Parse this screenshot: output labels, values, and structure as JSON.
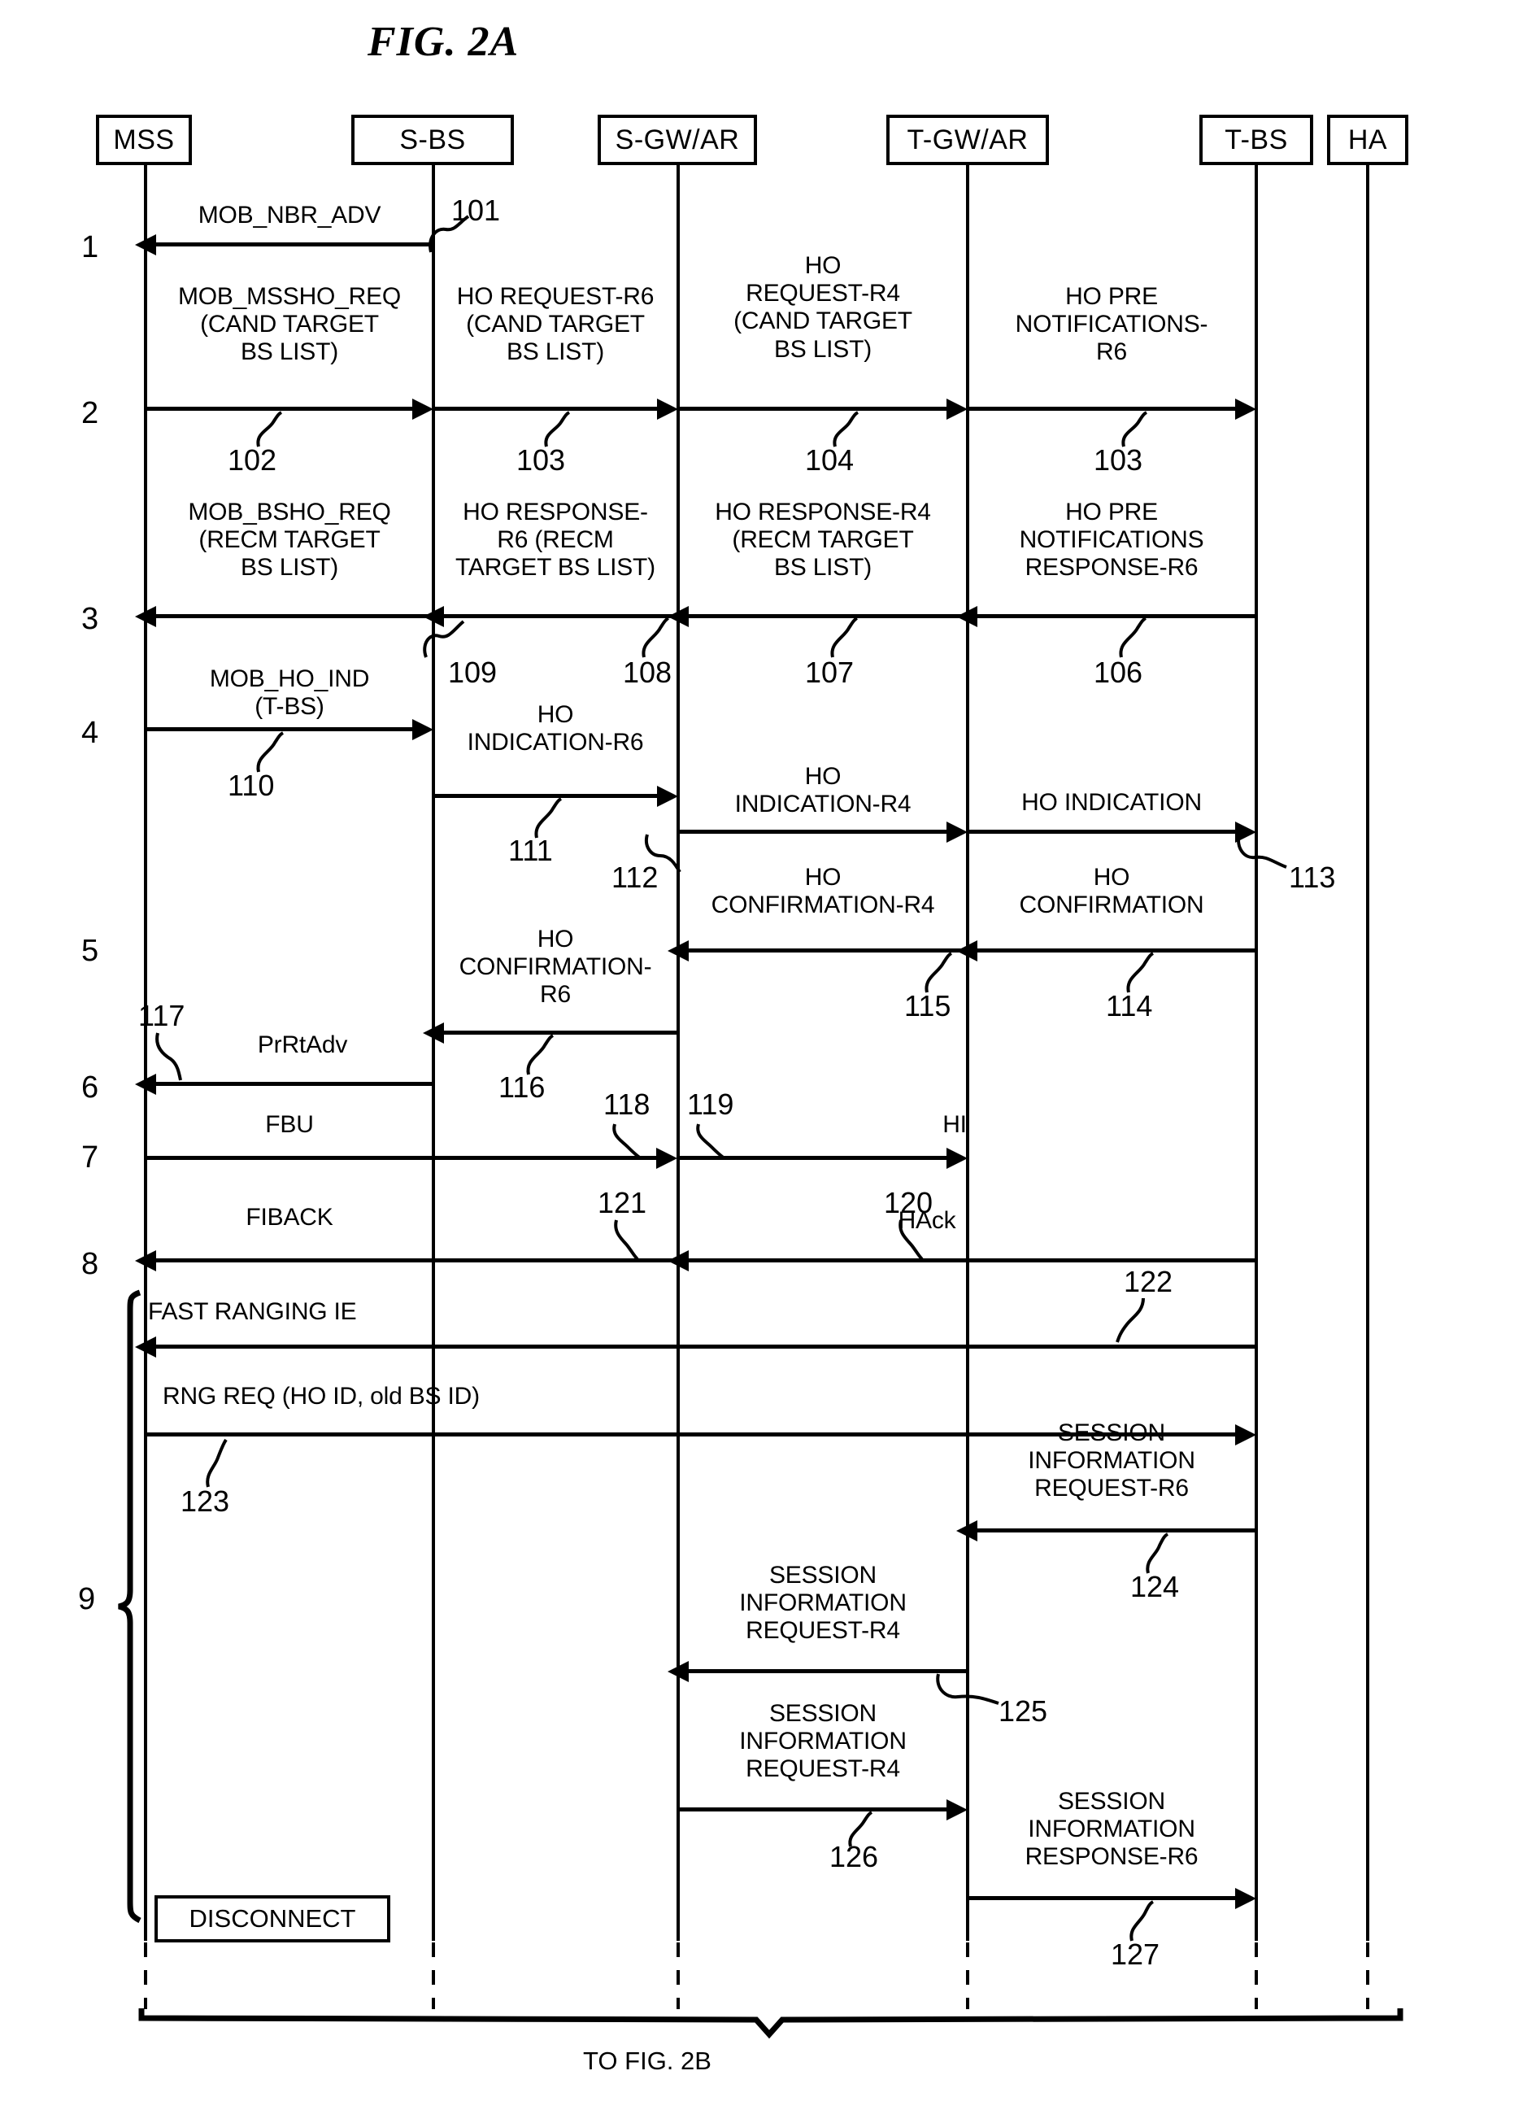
{
  "figure": {
    "title": "FIG. 2A",
    "bottom_caption": "TO FIG. 2B"
  },
  "entities": [
    {
      "id": "mss",
      "label": "MSS"
    },
    {
      "id": "sbs",
      "label": "S-BS"
    },
    {
      "id": "sgwar",
      "label": "S-GW/AR"
    },
    {
      "id": "tgwar",
      "label": "T-GW/AR"
    },
    {
      "id": "tbs",
      "label": "T-BS"
    },
    {
      "id": "ha",
      "label": "HA"
    }
  ],
  "step_numbers": [
    "1",
    "2",
    "3",
    "4",
    "5",
    "6",
    "7",
    "8",
    "9"
  ],
  "messages": [
    {
      "id": "m101",
      "label": "MOB_NBR_ADV",
      "from": "sbs",
      "to": "mss",
      "dir": "left",
      "ref": "101"
    },
    {
      "id": "m102",
      "label": "MOB_MSSHO_REQ\n(CAND TARGET\nBS LIST)",
      "from": "mss",
      "to": "sbs",
      "dir": "right",
      "ref": "102"
    },
    {
      "id": "m103",
      "label": "HO REQUEST-R6\n(CAND TARGET\nBS LIST)",
      "from": "sbs",
      "to": "sgwar",
      "dir": "right",
      "ref": "103"
    },
    {
      "id": "m104",
      "label": "HO\nREQUEST-R4\n(CAND TARGET\nBS LIST)",
      "from": "sgwar",
      "to": "tgwar",
      "dir": "right",
      "ref": "104"
    },
    {
      "id": "m105",
      "label": "HO PRE\nNOTIFICATIONS-\nR6",
      "from": "tgwar",
      "to": "tbs",
      "dir": "right",
      "ref": "103"
    },
    {
      "id": "m106",
      "label": "HO PRE\nNOTIFICATIONS\nRESPONSE-R6",
      "from": "tbs",
      "to": "tgwar",
      "dir": "left",
      "ref": "106"
    },
    {
      "id": "m107",
      "label": "HO RESPONSE-R4\n(RECM TARGET\nBS LIST)",
      "from": "tgwar",
      "to": "sgwar",
      "dir": "left",
      "ref": "107"
    },
    {
      "id": "m108",
      "label": "HO RESPONSE-\nR6 (RECM\nTARGET BS LIST)",
      "from": "sgwar",
      "to": "sbs",
      "dir": "left",
      "ref": "108"
    },
    {
      "id": "m109",
      "label": "MOB_BSHO_REQ\n(RECM TARGET\nBS LIST)",
      "from": "sbs",
      "to": "mss",
      "dir": "left",
      "ref": "109"
    },
    {
      "id": "m110",
      "label": "MOB_HO_IND\n(T-BS)",
      "from": "mss",
      "to": "sbs",
      "dir": "right",
      "ref": "110"
    },
    {
      "id": "m111",
      "label": "HO\nINDICATION-R6",
      "from": "sbs",
      "to": "sgwar",
      "dir": "right",
      "ref": "111"
    },
    {
      "id": "m112",
      "label": "HO\nINDICATION-R4",
      "from": "sgwar",
      "to": "tgwar",
      "dir": "right",
      "ref": "112"
    },
    {
      "id": "m113",
      "label": "HO INDICATION",
      "from": "tgwar",
      "to": "tbs",
      "dir": "right",
      "ref": "113"
    },
    {
      "id": "m114",
      "label": "HO\nCONFIRMATION",
      "from": "tbs",
      "to": "tgwar",
      "dir": "left",
      "ref": "114"
    },
    {
      "id": "m115",
      "label": "HO\nCONFIRMATION-R4",
      "from": "tgwar",
      "to": "sgwar",
      "dir": "left",
      "ref": "115"
    },
    {
      "id": "m116",
      "label": "HO\nCONFIRMATION-\nR6",
      "from": "sgwar",
      "to": "sbs",
      "dir": "left",
      "ref": "116"
    },
    {
      "id": "m117",
      "label": "PrRtAdv",
      "from": "sbs",
      "to": "mss",
      "dir": "left",
      "ref": "117"
    },
    {
      "id": "m118",
      "label": "FBU",
      "from": "mss",
      "to": "sgwar",
      "dir": "right",
      "ref": "118"
    },
    {
      "id": "m119",
      "label": "HI",
      "from": "sgwar",
      "to": "tgwar",
      "dir": "right",
      "ref": "119"
    },
    {
      "id": "m120",
      "label": "HAck",
      "from": "tgwar",
      "to": "sgwar",
      "dir": "left",
      "ref": "120"
    },
    {
      "id": "m121",
      "label": "FIBACK",
      "from": "sgwar",
      "to": "mss",
      "dir": "left",
      "ref": "121"
    },
    {
      "id": "m122",
      "label": "FAST RANGING IE",
      "from": "tbs",
      "to": "mss",
      "dir": "left",
      "ref": "122"
    },
    {
      "id": "m123",
      "label": "RNG REQ (HO ID, old BS ID)",
      "from": "mss",
      "to": "tbs",
      "dir": "right",
      "ref": "123"
    },
    {
      "id": "m124",
      "label": "SESSION\nINFORMATION\nREQUEST-R6",
      "from": "tbs",
      "to": "tgwar",
      "dir": "left",
      "ref": "124"
    },
    {
      "id": "m125",
      "label": "SESSION\nINFORMATION\nREQUEST-R4",
      "from": "tgwar",
      "to": "sgwar",
      "dir": "left",
      "ref": "125"
    },
    {
      "id": "m126",
      "label": "SESSION\nINFORMATION\nREQUEST-R4",
      "from": "sgwar",
      "to": "tgwar",
      "dir": "right",
      "ref": "126"
    },
    {
      "id": "m127",
      "label": "SESSION\nINFORMATION\nRESPONSE-R6",
      "from": "tgwar",
      "to": "tbs",
      "dir": "right",
      "ref": "127"
    }
  ],
  "boxes": [
    {
      "id": "disconnect",
      "label": "DISCONNECT"
    }
  ]
}
